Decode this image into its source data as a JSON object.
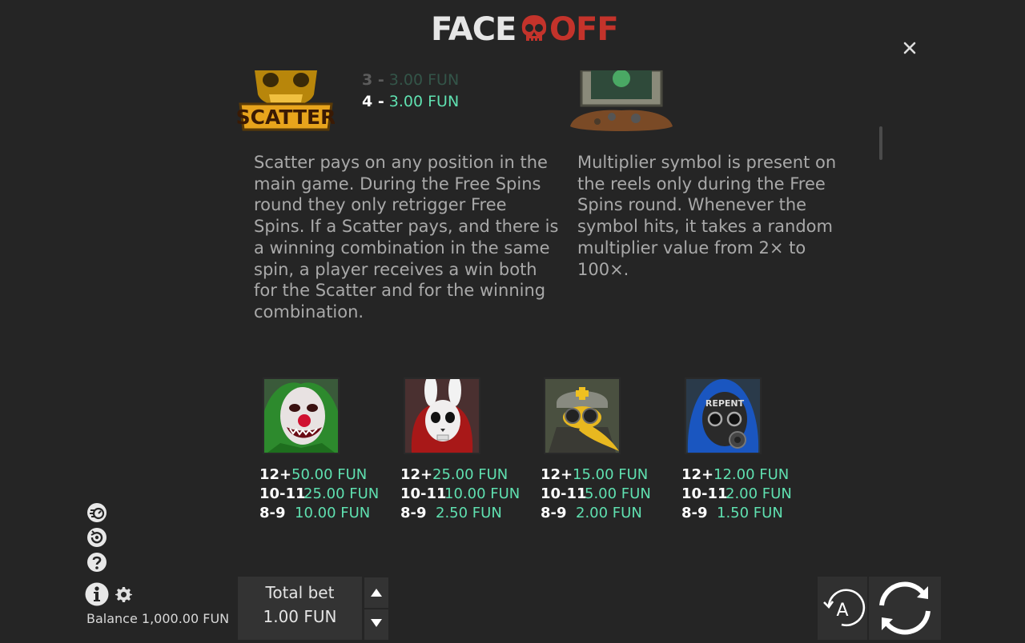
{
  "header": {
    "logo_part1": "FACE",
    "logo_part2": "OFF",
    "close_icon": "close-icon"
  },
  "colors": {
    "background": "#252525",
    "accent_green": "#5fe0b0",
    "logo_red": "#c4332b",
    "panel": "#333333"
  },
  "scatter": {
    "symbol_label": "SCATTER",
    "pays": [
      {
        "count": "3 -",
        "value": "3.00 FUN"
      },
      {
        "count": "4 -",
        "value": "3.00 FUN"
      }
    ],
    "description": "Scatter pays on any position in the main game. During the Free Spins round they only retrigger Free Spins. If a Scatter pays, and there is a winning combination in the same spin, a player receives a win both for the Scatter and for the winning combination."
  },
  "multiplier": {
    "symbol_label": "",
    "description": "Multiplier symbol is present on the reels only during the Free Spins round. Whenever the symbol hits, it takes a random multiplier value from 2× to 100×."
  },
  "symbols": [
    {
      "name": "clown",
      "pays": [
        {
          "count": "12+",
          "value": "50.00 FUN"
        },
        {
          "count": "10-11",
          "value": "25.00 FUN"
        },
        {
          "count": "8-9",
          "value": "10.00 FUN"
        }
      ]
    },
    {
      "name": "rabbit-mask",
      "pays": [
        {
          "count": "12+",
          "value": "25.00 FUN"
        },
        {
          "count": "10-11",
          "value": "10.00 FUN"
        },
        {
          "count": "8-9",
          "value": "2.50 FUN"
        }
      ]
    },
    {
      "name": "plague-doctor",
      "pays": [
        {
          "count": "12+",
          "value": "15.00 FUN"
        },
        {
          "count": "10-11",
          "value": "5.00 FUN"
        },
        {
          "count": "8-9",
          "value": "2.00 FUN"
        }
      ]
    },
    {
      "name": "gas-mask",
      "text": "REPENT",
      "pays": [
        {
          "count": "12+",
          "value": "12.00 FUN"
        },
        {
          "count": "10-11",
          "value": "2.00 FUN"
        },
        {
          "count": "8-9",
          "value": "1.50 FUN"
        }
      ]
    }
  ],
  "footer": {
    "side_icons": [
      "speed-icon",
      "history-icon",
      "help-icon"
    ],
    "balance": "Balance 1,000.00 FUN",
    "total_bet_label": "Total bet",
    "total_bet_value": "1.00 FUN",
    "autoplay_letter": "A"
  }
}
